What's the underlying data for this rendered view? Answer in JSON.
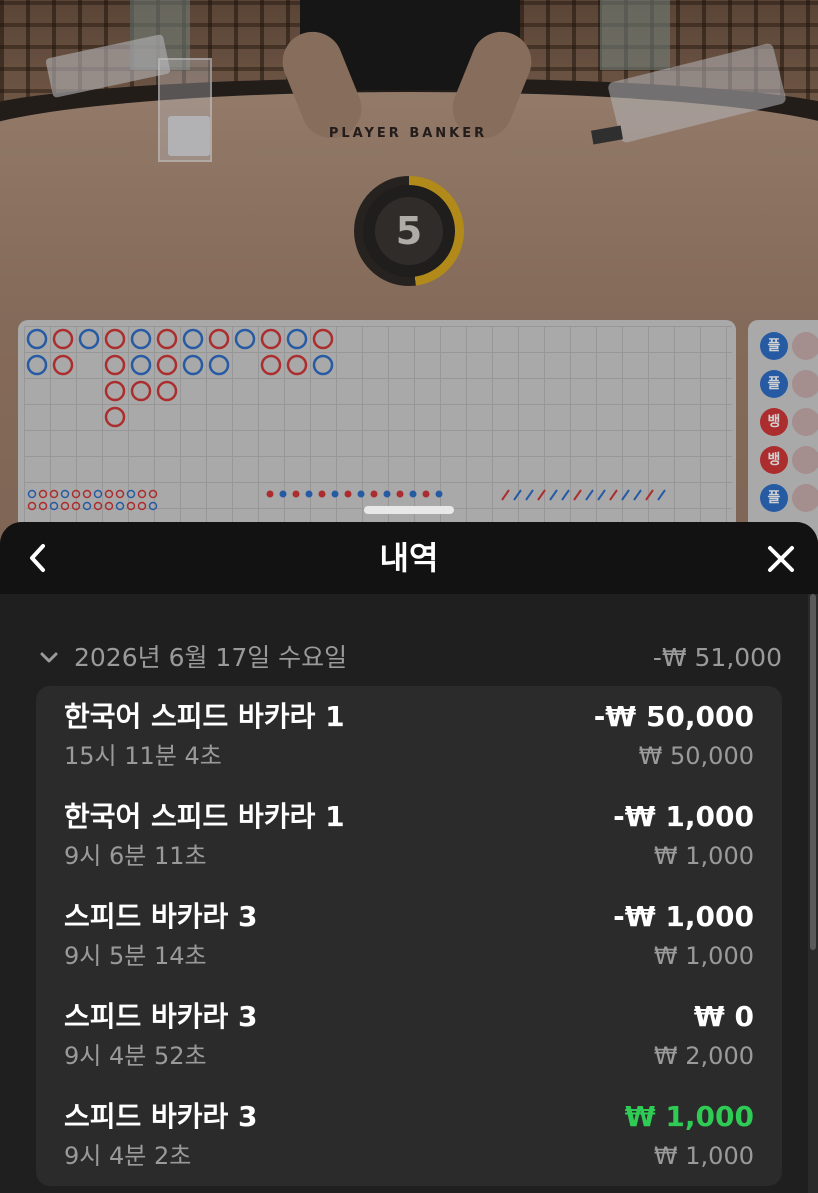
{
  "game": {
    "table_label": "PLAYER   BANKER",
    "timer": "5",
    "timer_progress": 0.48,
    "side_road": [
      "플",
      "플",
      "뱅",
      "뱅",
      "플"
    ]
  },
  "sheet": {
    "title": "내역",
    "back_icon": "chevron-left-icon",
    "close_icon": "close-icon"
  },
  "history": {
    "date": "2026년 6월 17일 수요일",
    "date_total": "-₩ 51,000",
    "entries": [
      {
        "game": "한국어 스피드 바카라 1",
        "time": "15시 11분 4초",
        "amount": "-₩ 50,000",
        "stake": "₩ 50,000"
      },
      {
        "game": "한국어 스피드 바카라 1",
        "time": "9시 6분 11초",
        "amount": "-₩ 1,000",
        "stake": "₩ 1,000"
      },
      {
        "game": "스피드 바카라 3",
        "time": "9시 5분 14초",
        "amount": "-₩ 1,000",
        "stake": "₩ 1,000"
      },
      {
        "game": "스피드 바카라 3",
        "time": "9시 4분 52초",
        "amount": "₩ 0",
        "stake": "₩ 2,000"
      },
      {
        "game": "스피드 바카라 3",
        "time": "9시 4분 2초",
        "amount": "₩ 1,000",
        "stake": "₩ 1,000"
      }
    ]
  },
  "colors": {
    "win": "#2ecc55",
    "player": "#2f6fc9",
    "banker": "#d23838",
    "timer": "#d8a920"
  }
}
